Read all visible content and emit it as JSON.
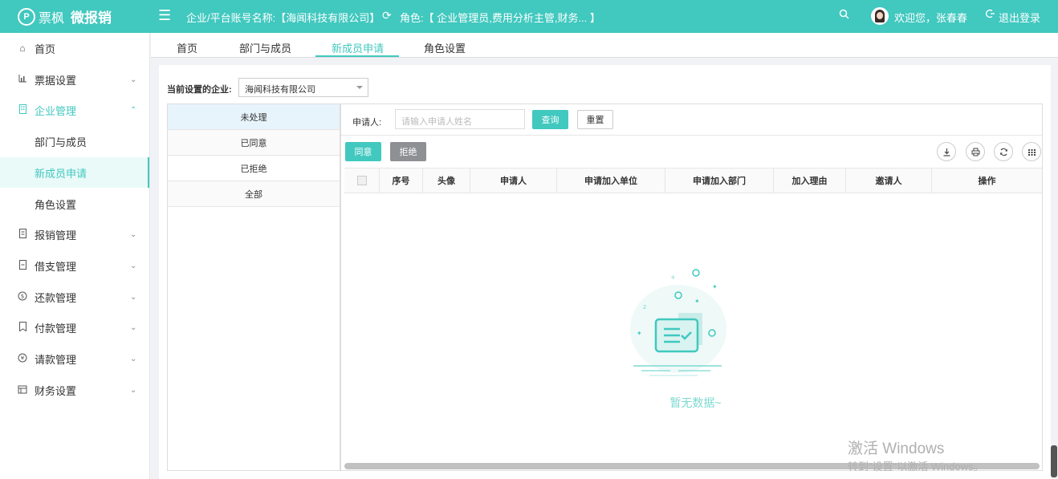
{
  "header": {
    "logo_mark": "P",
    "logo_brand": "票枫",
    "logo_product": "微报销",
    "company_label": "企业/平台账号名称:【海闻科技有限公司】",
    "role_label": "角色:【 企业管理员,费用分析主管,财务... 】",
    "welcome": "欢迎您，张春春",
    "logout": "退出登录"
  },
  "sidebar": {
    "items": [
      {
        "label": "首页",
        "icon": "home-icon"
      },
      {
        "label": "票据设置",
        "icon": "chart-icon"
      },
      {
        "label": "企业管理",
        "icon": "building-icon"
      },
      {
        "label": "部门与成员"
      },
      {
        "label": "新成员申请"
      },
      {
        "label": "角色设置"
      },
      {
        "label": "报销管理",
        "icon": "receipt-icon"
      },
      {
        "label": "借支管理",
        "icon": "document-icon"
      },
      {
        "label": "还款管理",
        "icon": "dollar-icon"
      },
      {
        "label": "付款管理",
        "icon": "payment-icon"
      },
      {
        "label": "请款管理",
        "icon": "yen-icon"
      },
      {
        "label": "财务设置",
        "icon": "settings-icon"
      }
    ]
  },
  "tabs": [
    {
      "label": "首页"
    },
    {
      "label": "部门与成员"
    },
    {
      "label": "新成员申请"
    },
    {
      "label": "角色设置"
    }
  ],
  "filter": {
    "company_label": "当前设置的企业:",
    "company_value": "海闻科技有限公司"
  },
  "status_list": [
    {
      "label": "未处理"
    },
    {
      "label": "已同意"
    },
    {
      "label": "已拒绝"
    },
    {
      "label": "全部"
    }
  ],
  "search": {
    "label": "申请人:",
    "placeholder": "请输入申请人姓名",
    "query_button": "查询",
    "reset_button": "重置"
  },
  "actions": {
    "agree": "同意",
    "reject": "拒绝"
  },
  "table": {
    "columns": [
      "序号",
      "头像",
      "申请人",
      "申请加入单位",
      "申请加入部门",
      "加入理由",
      "邀请人",
      "操作"
    ]
  },
  "empty_text": "暂无数据~",
  "watermark": {
    "line1": "激活 Windows",
    "line2": "转到\"设置\"以激活 Windows。"
  },
  "colors": {
    "accent": "#41c8bf",
    "reject": "#8e9094"
  }
}
